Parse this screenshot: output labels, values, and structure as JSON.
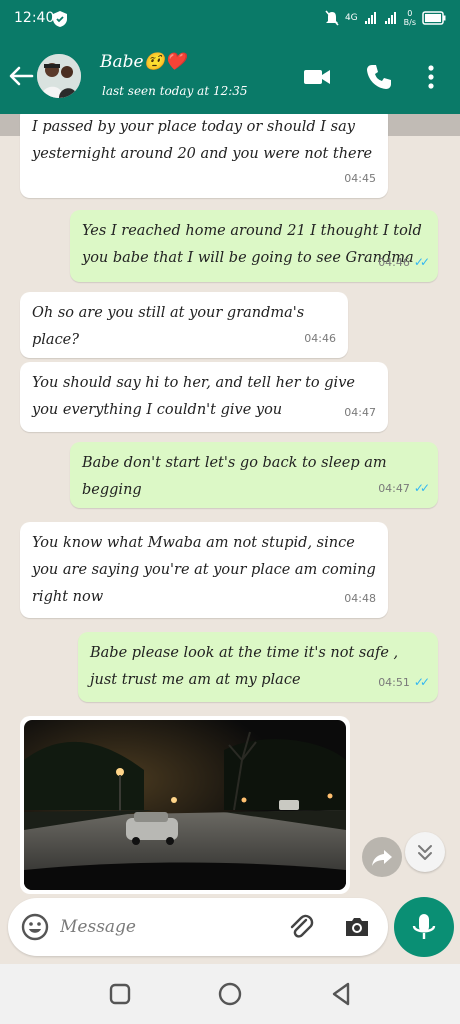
{
  "status_bar": {
    "time": "12:40",
    "network": "4G",
    "data_rate_top": "0",
    "data_rate_bottom": "B/s",
    "icons": [
      "shield-icon",
      "mute-icon",
      "signal-icon",
      "signal-icon",
      "battery-icon"
    ]
  },
  "header": {
    "contact_name": "Babe🤨❤️",
    "last_seen": "last seen today at 12:35",
    "icons": [
      "back-arrow-icon",
      "video-call-icon",
      "phone-icon",
      "more-vert-icon"
    ]
  },
  "messages": [
    {
      "direction": "in",
      "text": "I passed by your place today or should I say yesternight around 20 and you were not there",
      "time": "04:45"
    },
    {
      "direction": "out",
      "text": "Yes I reached home around 21 I thought I told you babe that I will be going to see Grandma",
      "time": "04:46",
      "status": "read"
    },
    {
      "direction": "in",
      "text": "Oh so are you still at your grandma's place?",
      "time": "04:46"
    },
    {
      "direction": "in",
      "text": "You should say hi to her, and tell her to give you everything I couldn't give you",
      "time": "04:47"
    },
    {
      "direction": "out",
      "text": "Babe don't start let's go back to sleep am begging",
      "time": "04:47",
      "status": "read"
    },
    {
      "direction": "in",
      "text": "You know what Mwaba am not stupid, since you are saying you're at your place am coming right now",
      "time": "04:48"
    },
    {
      "direction": "out",
      "text": "Babe please look at the time it's not safe , just trust me am at my place",
      "time": "04:51",
      "status": "read"
    }
  ],
  "image_message": {
    "direction": "in",
    "content": "night-street-photo"
  },
  "input": {
    "placeholder": "Message"
  },
  "colors": {
    "header": "#0a7a68",
    "incoming_bubble": "#ffffff",
    "outgoing_bubble": "#dcf8c6",
    "read_ticks": "#34b7f1",
    "chat_background": "#ece5dd",
    "mic_button": "#0a8f74"
  }
}
